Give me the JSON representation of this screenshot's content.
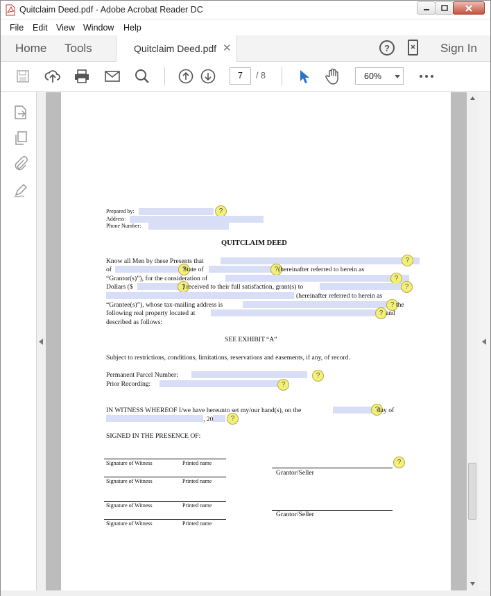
{
  "window": {
    "title": "Quitclaim Deed.pdf - Adobe Acrobat Reader DC"
  },
  "menu": [
    "File",
    "Edit",
    "View",
    "Window",
    "Help"
  ],
  "tabs": {
    "home": "Home",
    "tools": "Tools",
    "document": "Quitclaim Deed.pdf",
    "sign_in": "Sign In"
  },
  "toolbar": {
    "page_current": "7",
    "page_total": "/ 8",
    "zoom": "60%"
  },
  "icons": [
    "pdf-file-icon",
    "minimize-icon",
    "maximize-icon",
    "close-icon",
    "help-icon",
    "mobile-icon",
    "save-icon",
    "upload-icon",
    "print-icon",
    "email-icon",
    "search-icon",
    "page-up-icon",
    "page-down-icon",
    "select-cursor-icon",
    "hand-icon",
    "more-icon",
    "export-pdf-icon",
    "organize-pages-icon",
    "attachment-icon",
    "fill-sign-icon"
  ],
  "document": {
    "prepared_by": "Prepared by:",
    "address": "Address:",
    "phone": "Phone Number:",
    "title": "QUITCLAIM DEED",
    "p1": "Know all Men by these Presents that",
    "p2a": "of",
    "p2b": "State of",
    "p2c": "(hereinafter referred to herein as",
    "p3": "“Grantor(s)”), for the consideration of",
    "p4a": "Dollars ($",
    "p4b": ") received to their full satisfaction, grant(s) to",
    "p5": "(hereinafter referred to herein as",
    "p6a": "“Grantee(s)”), whose tax-mailing address is",
    "p6b": "the",
    "p7a": "following real property located at",
    "p7b": "and",
    "p8": "described as follows:",
    "exhibit": "SEE EXHIBIT “A”",
    "subject": "Subject to restrictions, conditions, limitations, reservations and easements, if any, of record.",
    "parcel": "Permanent Parcel Number:",
    "prior": "Prior Recording:",
    "witness_a": "IN WITNESS WHEREOF I/we have hereunto set my/our hand(s), on the",
    "witness_b": "day of",
    "witness_c": ", 20",
    "signed": "SIGNED IN THE PRESENCE OF:",
    "sig_witness": "Signature of Witness",
    "printed_name": "Printed name",
    "grantor": "Grantor/Seller"
  }
}
